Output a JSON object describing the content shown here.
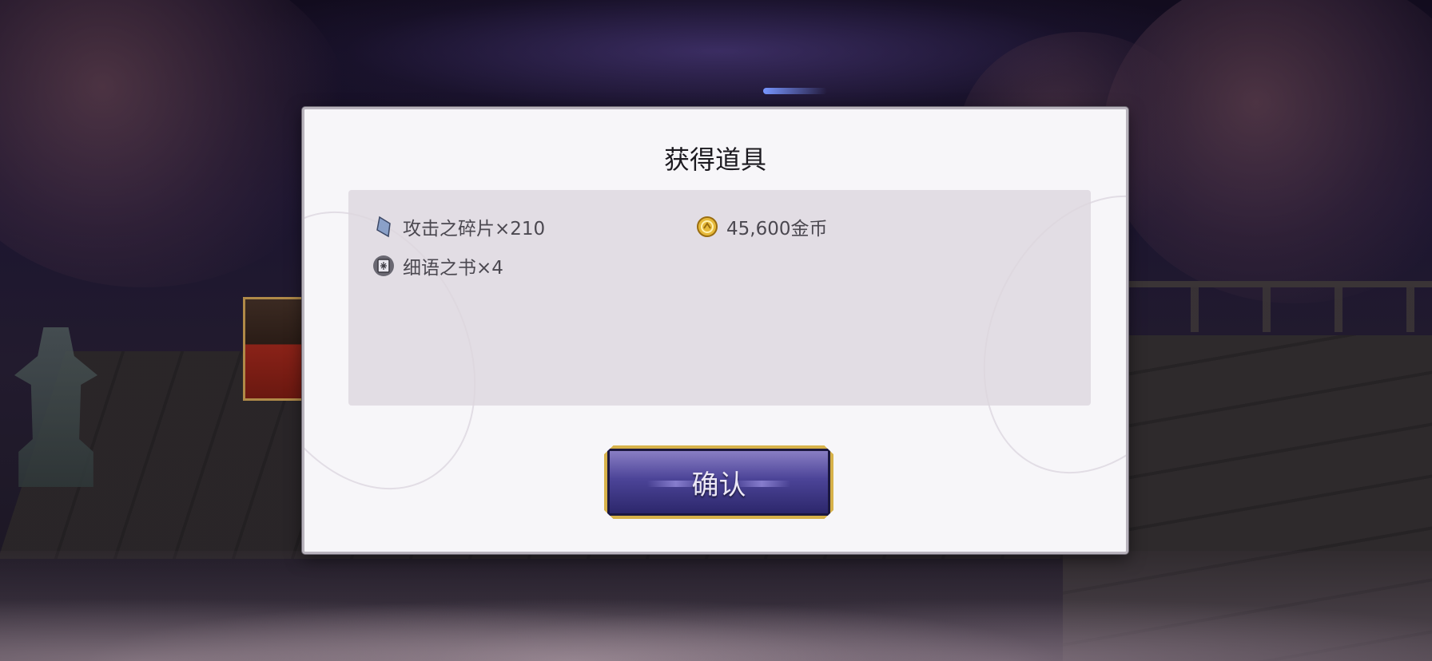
{
  "dialog": {
    "title": "获得道具",
    "confirm_label": "确认"
  },
  "items": [
    {
      "label": "攻击之碎片×210",
      "icon": "crystal-shard-icon"
    },
    {
      "label": "45,600金币",
      "icon": "gold-coin-icon"
    },
    {
      "label": "细语之书×4",
      "icon": "book-icon"
    }
  ],
  "colors": {
    "dialog_bg": "#f7f6f9",
    "panel_bg": "#dcd6de",
    "button_gold": "#d7b24a",
    "button_purple": "#4c4498"
  }
}
